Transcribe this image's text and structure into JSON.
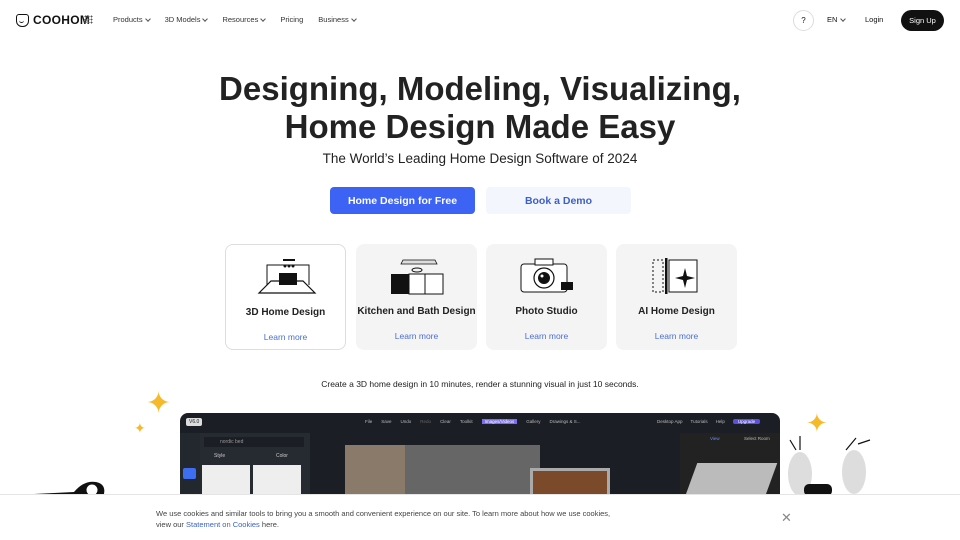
{
  "nav": {
    "brand": "COOHOM",
    "items": [
      {
        "label": "Products",
        "dropdown": true
      },
      {
        "label": "3D Models",
        "dropdown": true
      },
      {
        "label": "Resources",
        "dropdown": true
      },
      {
        "label": "Pricing",
        "dropdown": false
      },
      {
        "label": "Business",
        "dropdown": true
      }
    ],
    "help": "?",
    "lang": "EN",
    "login": "Login",
    "signup": "Sign Up"
  },
  "hero": {
    "title_line1": "Designing, Modeling, Visualizing,",
    "title_line2": "Home Design Made Easy",
    "subtitle": "The World’s Leading Home Design Software of 2024",
    "primary_cta": "Home Design for Free",
    "secondary_cta": "Book a Demo"
  },
  "cards": [
    {
      "title": "3D Home Design",
      "link": "Learn more",
      "icon": "3d-room-icon"
    },
    {
      "title": "Kitchen and Bath Design",
      "link": "Learn more",
      "icon": "kitchen-icon"
    },
    {
      "title": "Photo Studio",
      "link": "Learn more",
      "icon": "camera-icon"
    },
    {
      "title": "AI Home Design",
      "link": "Learn more",
      "icon": "ai-sparkle-icon"
    }
  ],
  "tagline": "Create a 3D home design in 10 minutes, render a stunning visual in just 10 seconds.",
  "app_preview": {
    "version": "V6.0",
    "search": "nordic bed",
    "filters": [
      "Style",
      "Color"
    ],
    "toolbar": [
      "File",
      "Save",
      "Undo",
      "Redo",
      "Clear",
      "Toolkit",
      "Images/Videos",
      "Gallery",
      "Drawings & S...",
      "Desktop App",
      "Tutorials",
      "Help"
    ],
    "upgrade": "Upgrade",
    "tabs": [
      "View",
      "Select Room"
    ]
  },
  "cookie": {
    "text": "We use cookies and similar tools to bring you a smooth and convenient experience on our site. To learn more about how we use cookies, view our ",
    "link": "Statement on Cookies",
    "suffix": " here."
  }
}
